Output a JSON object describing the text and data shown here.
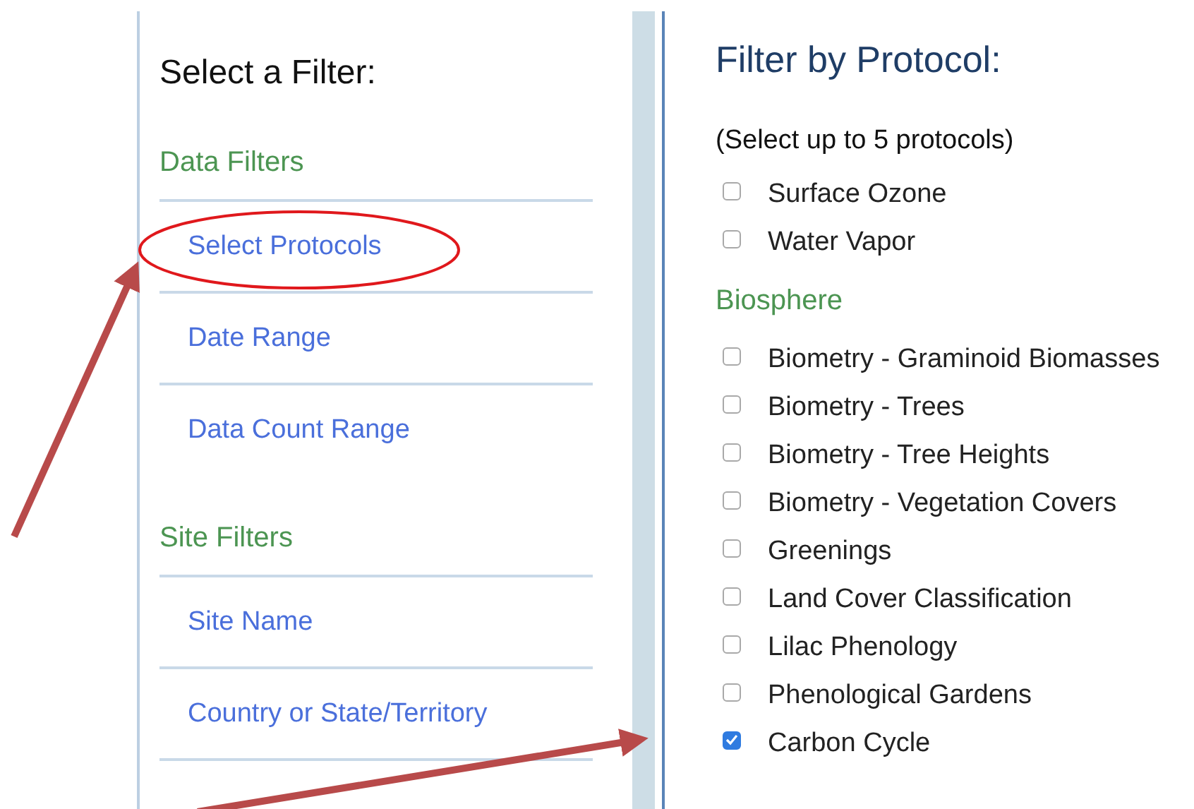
{
  "sidebar": {
    "title": "Select a Filter:",
    "sections": [
      {
        "heading": "Data Filters",
        "items": [
          {
            "label": "Select Protocols"
          },
          {
            "label": "Date Range"
          },
          {
            "label": "Data Count Range"
          }
        ]
      },
      {
        "heading": "Site Filters",
        "items": [
          {
            "label": "Site Name"
          },
          {
            "label": "Country or State/Territory"
          }
        ]
      }
    ]
  },
  "filter_panel": {
    "title": "Filter by Protocol:",
    "hint": "(Select up to 5 protocols)",
    "groups": [
      {
        "items": [
          {
            "label": "Surface Ozone",
            "checked": false
          },
          {
            "label": "Water Vapor",
            "checked": false
          }
        ]
      },
      {
        "heading": "Biosphere",
        "items": [
          {
            "label": "Biometry - Graminoid Biomasses",
            "checked": false
          },
          {
            "label": "Biometry - Trees",
            "checked": false
          },
          {
            "label": "Biometry - Tree Heights",
            "checked": false
          },
          {
            "label": "Biometry - Vegetation Covers",
            "checked": false
          },
          {
            "label": "Greenings",
            "checked": false
          },
          {
            "label": "Land Cover Classification",
            "checked": false
          },
          {
            "label": "Lilac Phenology",
            "checked": false
          },
          {
            "label": "Phenological Gardens",
            "checked": false
          },
          {
            "label": "Carbon Cycle",
            "checked": true
          }
        ]
      }
    ]
  }
}
